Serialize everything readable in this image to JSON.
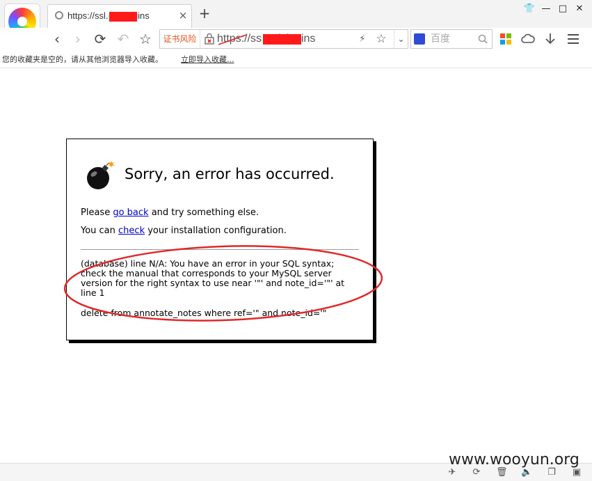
{
  "tab": {
    "title": "https://ssl.        at/plugins",
    "close": "×",
    "new_tab": "+"
  },
  "window_controls": {
    "skin": "👕",
    "minimize": "—",
    "maximize": "□",
    "close": "✕"
  },
  "toolbar": {
    "back": "‹",
    "forward": "›",
    "reload": "⟳",
    "undo": "↶",
    "favorite": "☆"
  },
  "address_bar": {
    "cert_warning": "证书风险",
    "url": "https://ss        .at/plugins",
    "bolt": "⚡",
    "star": "☆",
    "dropdown": "⌄"
  },
  "search": {
    "placeholder": "百度"
  },
  "bookmarks_bar": {
    "message": "您的收藏夹是空的，请从其他浏览器导入收藏。",
    "import_link": "立即导入收藏..."
  },
  "error_page": {
    "title": "Sorry, an error has occurred.",
    "line1_prefix": "Please ",
    "line1_link": "go back",
    "line1_suffix": " and try something else.",
    "line2_prefix": "You can ",
    "line2_link": "check",
    "line2_suffix": " your installation configuration.",
    "message": "(database) line N/A: You have an error in your SQL syntax; check the manual that corresponds to your MySQL server version for the right syntax to use near '\"' and note_id='\"' at line 1",
    "sql": "delete from annotate_notes where ref='\" and note_id='\""
  },
  "watermark": "www.wooyun.org",
  "colors": {
    "cert_warning": "#e0541c",
    "link": "#0000cc",
    "annotation_red": "#e0282a",
    "redaction": "#ff1a1a"
  }
}
